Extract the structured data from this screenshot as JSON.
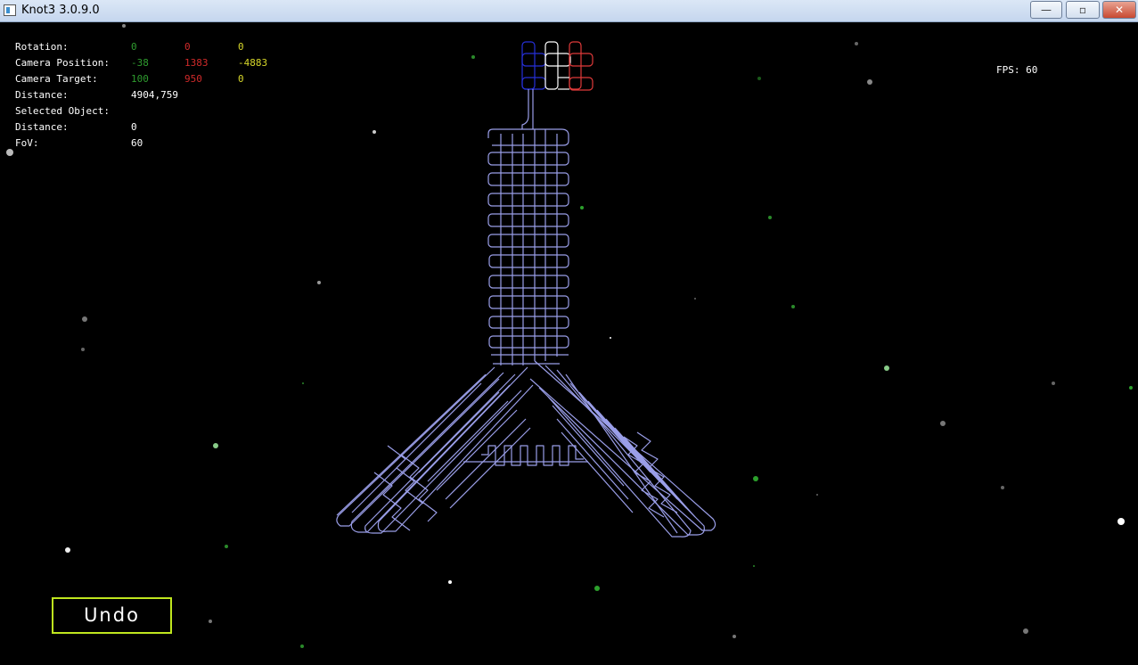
{
  "window": {
    "title": "Knot3 3.0.9.0",
    "minimize": "—",
    "maximize": "▫",
    "close": "✕"
  },
  "hud": {
    "rows": [
      {
        "label": "Rotation:",
        "v1": "0",
        "v2": "0",
        "v3": "0"
      },
      {
        "label": "Camera Position:",
        "v1": "-38",
        "v2": "1383",
        "v3": "-4883"
      },
      {
        "label": "Camera Target:",
        "v1": "100",
        "v2": "950",
        "v3": "0"
      },
      {
        "label": "Distance:",
        "v1": "4904,759"
      },
      {
        "label": "Selected Object:",
        "v1": ""
      },
      {
        "label": "Distance:",
        "v1": "0"
      },
      {
        "label": "FoV:",
        "v1": "60"
      }
    ]
  },
  "fps": "FPS: 60",
  "undo_label": "Undo",
  "colors": {
    "green": "#2f9c2f",
    "red": "#d02a2a",
    "yellow": "#d6d62a",
    "knot": "#9a9ee8",
    "undo_border": "#bfe61e"
  }
}
